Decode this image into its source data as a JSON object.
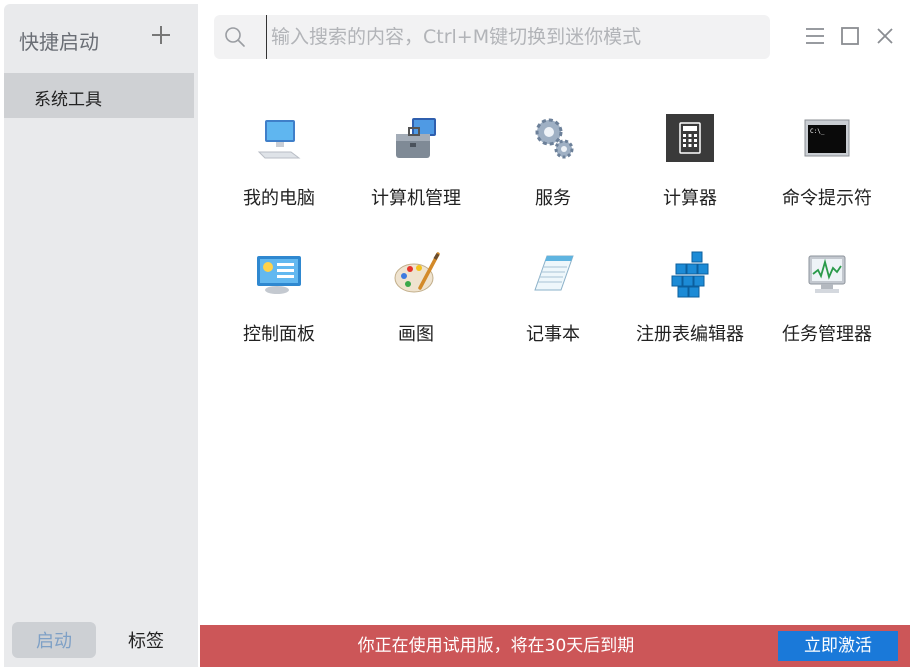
{
  "sidebar": {
    "title": "快捷启动",
    "add_icon": "plus-icon",
    "items": [
      {
        "label": "系统工具",
        "selected": true
      }
    ],
    "bottom_tabs": [
      {
        "label": "启动",
        "selected": true
      },
      {
        "label": "标签",
        "selected": false
      }
    ]
  },
  "search": {
    "placeholder": "输入搜索的内容，Ctrl+M键切换到迷你模式",
    "value": "",
    "icon": "search-icon"
  },
  "window_controls": [
    "menu-icon",
    "maximize-icon",
    "close-icon"
  ],
  "tools": [
    {
      "label": "我的电脑",
      "icon": "computer-icon"
    },
    {
      "label": "计算机管理",
      "icon": "computer-management-icon"
    },
    {
      "label": "服务",
      "icon": "services-gears-icon"
    },
    {
      "label": "计算器",
      "icon": "calculator-icon"
    },
    {
      "label": "命令提示符",
      "icon": "command-prompt-icon"
    },
    {
      "label": "控制面板",
      "icon": "control-panel-icon"
    },
    {
      "label": "画图",
      "icon": "paint-palette-icon"
    },
    {
      "label": "记事本",
      "icon": "notepad-icon"
    },
    {
      "label": "注册表编辑器",
      "icon": "registry-editor-icon"
    },
    {
      "label": "任务管理器",
      "icon": "task-manager-icon"
    }
  ],
  "banner": {
    "text": "你正在使用试用版，将在30天后到期",
    "button_label": "立即激活",
    "background": "#cc5658",
    "button_color": "#1a79d9"
  }
}
